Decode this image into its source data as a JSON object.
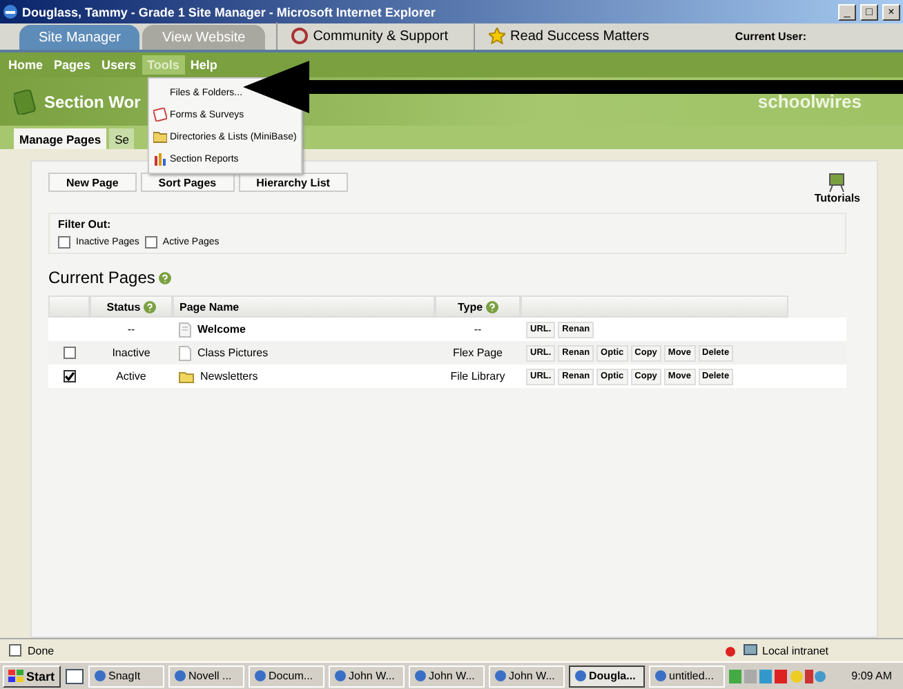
{
  "window": {
    "title": "Douglass, Tammy - Grade 1 Site Manager - Microsoft Internet Explorer",
    "controls": [
      "_",
      "□",
      "×"
    ]
  },
  "top_tabs": [
    {
      "label": "Site Manager",
      "selected": true
    },
    {
      "label": "View Website",
      "selected": false
    }
  ],
  "top_links": [
    {
      "label": "Community & Support",
      "kind": "lifebuoy"
    },
    {
      "label": "Read Success Matters",
      "kind": "star"
    }
  ],
  "current_user": "Current User:",
  "nav": [
    {
      "label": "Home",
      "selected": false
    },
    {
      "label": "Pages",
      "selected": false
    },
    {
      "label": "Users",
      "selected": false
    },
    {
      "label": "Tools",
      "selected": true
    },
    {
      "label": "Help",
      "selected": false
    }
  ],
  "tools_menu": [
    {
      "label": "Files & Folders...",
      "kind": "none"
    },
    {
      "label": "Forms & Surveys",
      "kind": "form"
    },
    {
      "label": "Directories & Lists (MiniBase)",
      "kind": "folder"
    },
    {
      "label": "Section Reports",
      "kind": "chart"
    }
  ],
  "header": {
    "title": "Section Wor",
    "logo": "schoolwires"
  },
  "section_tabs": [
    {
      "label": "Manage Pages",
      "selected": true
    },
    {
      "label": "Se",
      "selected": false
    }
  ],
  "toolbar": [
    "New Page",
    "Sort Pages",
    "Hierarchy List"
  ],
  "tutorials": "Tutorials",
  "filter": {
    "title": "Filter Out:",
    "options": [
      {
        "label": "Inactive Pages",
        "checked": false
      },
      {
        "label": "Active Pages",
        "checked": false
      }
    ]
  },
  "current_pages": {
    "title": "Current Pages",
    "columns": [
      {
        "label": "Status",
        "help": true
      },
      {
        "label": "Page Name",
        "help": false
      },
      {
        "label": "Type",
        "help": true
      }
    ],
    "rows": [
      {
        "checkbox": false,
        "status": "--",
        "name": "Welcome",
        "bold": true,
        "kind": "page",
        "type": "--",
        "actions": [
          "URL.",
          "Renan"
        ]
      },
      {
        "checkbox": true,
        "checked": false,
        "status": "Inactive",
        "name": "Class Pictures",
        "bold": false,
        "kind": "blank",
        "type": "Flex Page",
        "actions": [
          "URL.",
          "Renan",
          "Optic",
          "Copy",
          "Move",
          "Delete"
        ]
      },
      {
        "checkbox": true,
        "checked": true,
        "status": "Active",
        "name": "Newsletters",
        "bold": false,
        "kind": "folder",
        "type": "File Library",
        "actions": [
          "URL.",
          "Renan",
          "Optic",
          "Copy",
          "Move",
          "Delete"
        ]
      }
    ]
  },
  "status_bar": {
    "text": "Done",
    "zone": "Local intranet"
  },
  "taskbar": {
    "start": "Start",
    "items": [
      {
        "label": "SnagIt",
        "selected": false
      },
      {
        "label": "Novell ...",
        "selected": false
      },
      {
        "label": "Docum...",
        "selected": false
      },
      {
        "label": "John W...",
        "selected": false
      },
      {
        "label": "John W...",
        "selected": false
      },
      {
        "label": "John W...",
        "selected": false
      },
      {
        "label": "Dougla...",
        "selected": true
      },
      {
        "label": "untitled...",
        "selected": false
      }
    ],
    "clock": "9:09 AM"
  }
}
